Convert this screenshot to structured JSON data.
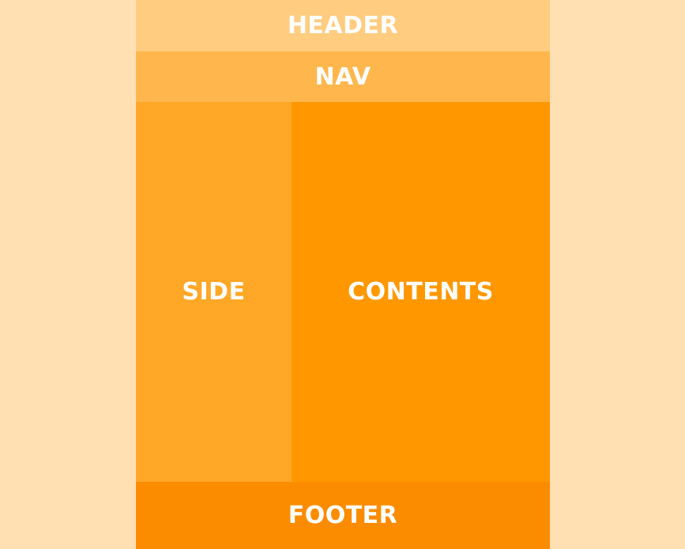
{
  "layout": {
    "header": {
      "label": "HEADER"
    },
    "nav": {
      "label": "NAV"
    },
    "side": {
      "label": "SIDE"
    },
    "contents": {
      "label": "CONTENTS"
    },
    "footer": {
      "label": "FOOTER"
    }
  },
  "colors": {
    "background": "#ffe0b3",
    "header": "#ffcc80",
    "nav": "#ffb74d",
    "side": "#ffa726",
    "contents": "#ff9800",
    "footer": "#fb8c00",
    "text": "#ffffff"
  }
}
